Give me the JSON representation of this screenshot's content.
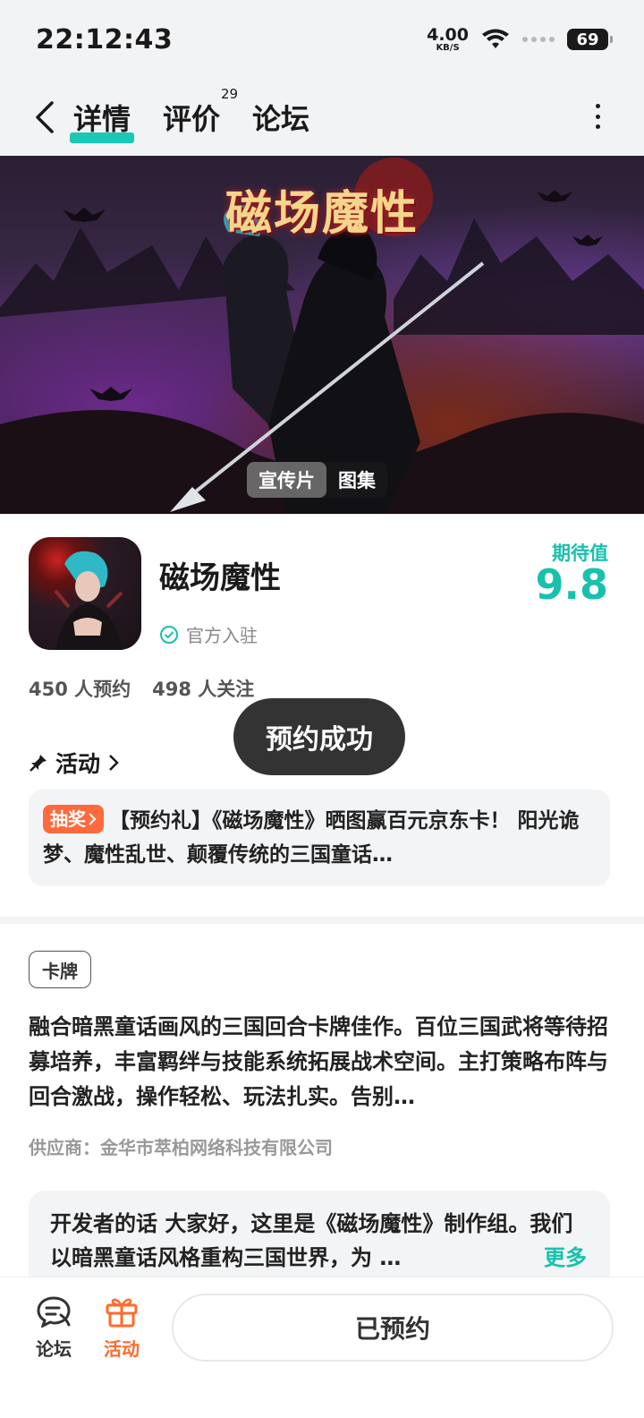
{
  "status_bar": {
    "time": "22:12:43",
    "net_speed_value": "4.00",
    "net_speed_unit": "KB/S",
    "battery": "69"
  },
  "nav": {
    "tabs": [
      {
        "label": "详情",
        "active": true
      },
      {
        "label": "评价",
        "badge": "29"
      },
      {
        "label": "论坛"
      }
    ]
  },
  "banner": {
    "title": "磁场魔性",
    "media_tabs": [
      "宣传片",
      "图集"
    ]
  },
  "app": {
    "name": "磁场魔性",
    "verified_label": "官方入驻",
    "score_label": "期待值",
    "score_value": "9.8",
    "reservations": "450 人预约",
    "followers": "498 人关注"
  },
  "toast": "预约成功",
  "activity": {
    "heading": "活动",
    "badge": "抽奖",
    "text": "【预约礼】《磁场魔性》晒图赢百元京东卡！ 阳光诡梦、魔性乱世、颠覆传统的三国童话…"
  },
  "details": {
    "tag": "卡牌",
    "description": "融合暗黑童话画风的三国回合卡牌佳作。百位三国武将等待招募培养，丰富羁绊与技能系统拓展战术空间。主打策略布阵与回合激战，操作轻松、玩法扎实。告别…",
    "supplier": "供应商：金华市萃柏网络科技有限公司"
  },
  "developer_note": {
    "text": "开发者的话  大家好，这里是《磁场魔性》制作组。我们以暗黑童话风格重构三国世界，为 …",
    "more": "更多"
  },
  "bottom_bar": {
    "forum_label": "论坛",
    "activity_label": "活动",
    "reserved_label": "已预约"
  },
  "colors": {
    "accent": "#19c1ad",
    "orange": "#ff6a3d",
    "toast_bg": "#333333"
  }
}
